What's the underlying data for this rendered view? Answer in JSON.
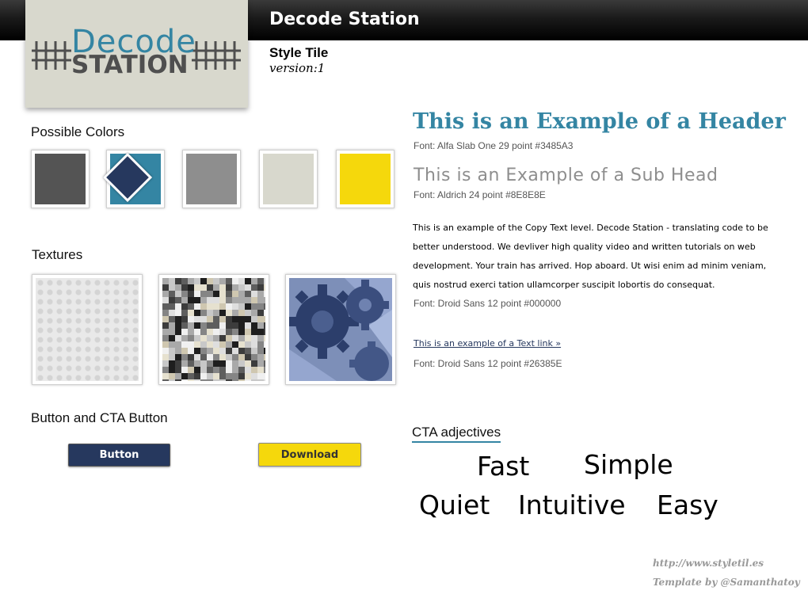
{
  "header": {
    "title": "Decode Station"
  },
  "logo": {
    "word1": "Decode",
    "word2": "STATION"
  },
  "tile": {
    "label": "Style Tile",
    "version": "version:1"
  },
  "colors_section": {
    "heading": "Possible Colors",
    "swatches": [
      "#545454",
      "#3485a3",
      "#8e8e8e",
      "#d8d8cd",
      "#f5d80c"
    ],
    "diamond_color": "#26385e"
  },
  "textures_section": {
    "heading": "Textures",
    "items": [
      "light-dots-texture",
      "mosaic-tile-texture",
      "blue-gears-texture"
    ]
  },
  "buttons_section": {
    "heading": "Button and CTA Button",
    "primary_label": "Button",
    "cta_label": "Download"
  },
  "typography": {
    "header_text": "This is an Example of a Header",
    "header_note": "Font: Alfa Slab One 29 point  #3485A3",
    "subhead_text": "This is an Example of a Sub Head",
    "subhead_note": "Font: Aldrich 24 point  #8E8E8E",
    "copy_text": "This is an example of the Copy Text level. Decode Station - translating code to be better understood. We devliver high quality video and written  tutorials  on web development. Your train has arrived. Hop aboard. Ut wisi enim ad minim veniam, quis nostrud exerci tation ullamcorper suscipit lobortis do consequat.",
    "copy_note": "Font: Droid Sans 12 point #000000",
    "link_text": "This is an example of a Text link »",
    "link_note": "Font: Droid Sans 12 point  #26385E"
  },
  "cta": {
    "heading": "CTA adjectives",
    "adjectives": [
      "Fast",
      "Simple",
      "Quiet",
      "Intuitive",
      "Easy"
    ]
  },
  "credits": {
    "url": "http://www.styletil.es",
    "author": "Template by @Samanthatoy"
  }
}
